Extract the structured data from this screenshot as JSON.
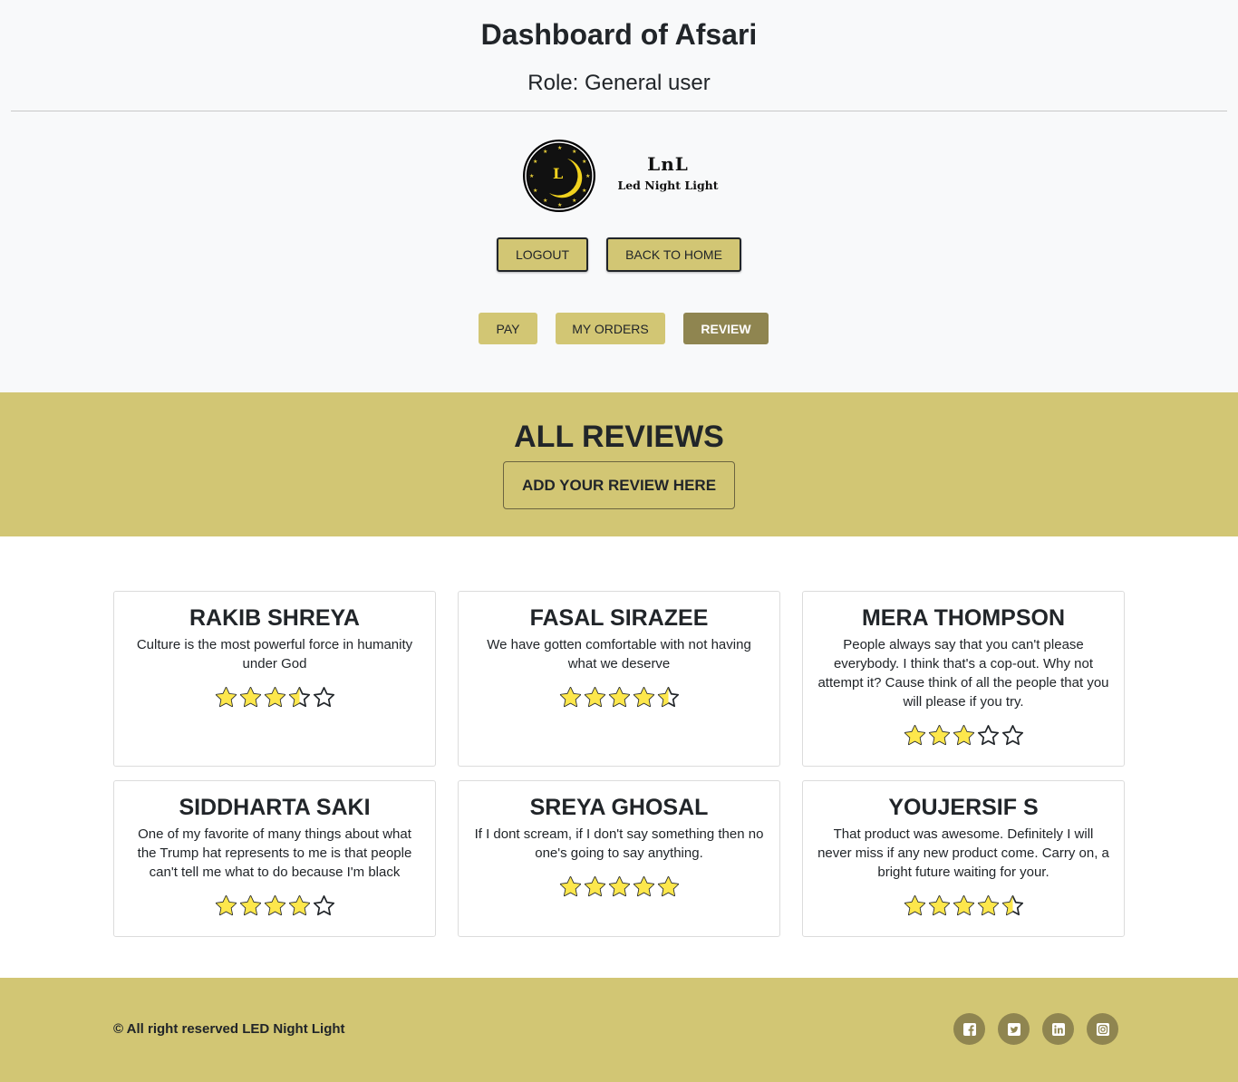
{
  "header": {
    "title": "Dashboard of Afsari",
    "role": "Role: General user"
  },
  "logo": {
    "letter": "L",
    "abbr": "LnL",
    "full": "Led Night Light"
  },
  "actions": {
    "logout": "LOGOUT",
    "back_home": "BACK TO HOME"
  },
  "tabs": [
    {
      "label": "PAY",
      "active": false
    },
    {
      "label": "MY ORDERS",
      "active": false
    },
    {
      "label": "REVIEW",
      "active": true
    }
  ],
  "reviews_section": {
    "title": "ALL REVIEWS",
    "add_button": "ADD YOUR REVIEW HERE"
  },
  "reviews": [
    {
      "name": "RAKIB SHREYA",
      "text": "Culture is the most powerful force in humanity under God",
      "rating": 3.5
    },
    {
      "name": "FASAL SIRAZEE",
      "text": "We have gotten comfortable with not having what we deserve",
      "rating": 4.5
    },
    {
      "name": "MERA THOMPSON",
      "text": "People always say that you can't please everybody. I think that's a cop-out. Why not attempt it? Cause think of all the people that you will please if you try.",
      "rating": 3
    },
    {
      "name": "SIDDHARTA SAKI",
      "text": "One of my favorite of many things about what the Trump hat represents to me is that people can't tell me what to do because I'm black",
      "rating": 4
    },
    {
      "name": "SREYA GHOSAL",
      "text": "If I dont scream, if I don't say something then no one's going to say anything.",
      "rating": 5
    },
    {
      "name": "YOUJERSIF S",
      "text": "That product was awesome. Definitely I will never miss if any new product come. Carry on, a bright future waiting for your.",
      "rating": 4.5
    }
  ],
  "footer": {
    "copyright": "© All right reserved LED Night Light",
    "social": [
      "facebook-icon",
      "twitter-icon",
      "linkedin-icon",
      "instagram-icon"
    ]
  },
  "colors": {
    "accent": "#d2c674",
    "accent_dark": "#8f8550",
    "star": "#fde74c"
  }
}
